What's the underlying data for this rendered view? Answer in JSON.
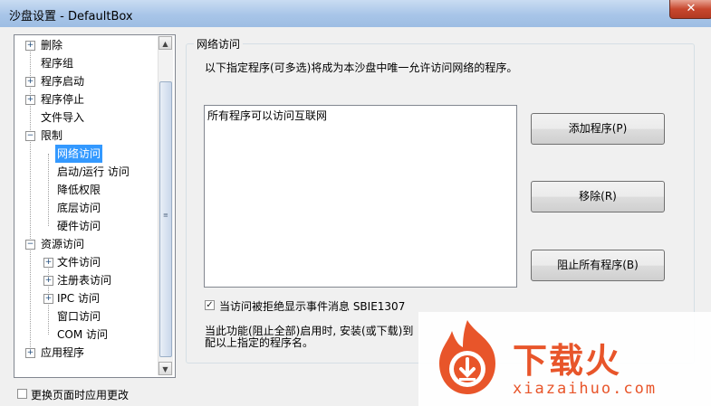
{
  "window": {
    "title": "沙盘设置 - DefaultBox",
    "close_glyph": "✕"
  },
  "tree": {
    "items": [
      {
        "label": "删除",
        "expander": "+"
      },
      {
        "label": "程序组",
        "expander": ""
      },
      {
        "label": "程序启动",
        "expander": "+"
      },
      {
        "label": "程序停止",
        "expander": "+"
      },
      {
        "label": "文件导入",
        "expander": ""
      },
      {
        "label": "限制",
        "expander": "−"
      },
      {
        "label": "网络访问",
        "expander": "",
        "selected": true
      },
      {
        "label": "启动/运行 访问",
        "expander": ""
      },
      {
        "label": "降低权限",
        "expander": ""
      },
      {
        "label": "底层访问",
        "expander": ""
      },
      {
        "label": "硬件访问",
        "expander": ""
      },
      {
        "label": "资源访问",
        "expander": "−"
      },
      {
        "label": "文件访问",
        "expander": "+"
      },
      {
        "label": "注册表访问",
        "expander": "+"
      },
      {
        "label": "IPC 访问",
        "expander": "+"
      },
      {
        "label": "窗口访问",
        "expander": ""
      },
      {
        "label": "COM 访问",
        "expander": ""
      },
      {
        "label": "应用程序",
        "expander": "+"
      }
    ]
  },
  "panel": {
    "group_title": "网络访问",
    "description": "以下指定程序(可多选)将成为本沙盘中唯一允许访问网络的程序。",
    "list_items": [
      "所有程序可以访问互联网"
    ],
    "buttons": {
      "add": "添加程序(P)",
      "remove": "移除(R)",
      "block_all": "阻止所有程序(B)"
    },
    "checkbox_label": "当访问被拒绝显示事件消息 SBIE1307",
    "checkbox_checked": true,
    "note_line1": "当此功能(阻止全部)启用时, 安装(或下载)到",
    "note_line2": "配以上指定的程序名。"
  },
  "footer": {
    "apply_on_change_label": "更换页面时应用更改",
    "checked": false
  },
  "watermark": {
    "brand": "下载火",
    "url": "xiazaihuo.com"
  }
}
